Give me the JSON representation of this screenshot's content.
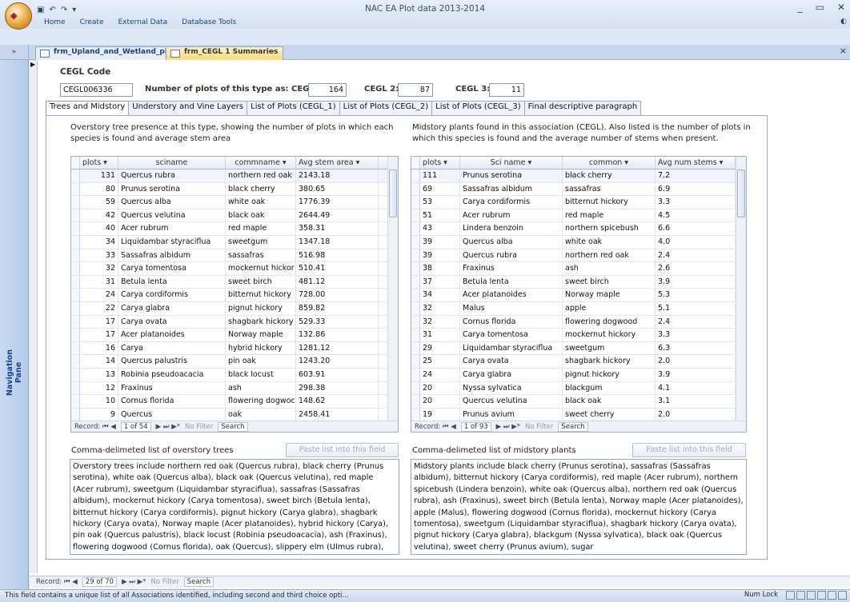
{
  "window": {
    "title": "NAC EA Plot data 2013-2014",
    "office_button": "Office",
    "quick_access": [
      "save-icon",
      "undo-icon",
      "redo-icon",
      "customize-icon"
    ],
    "controls": [
      "_",
      "▭",
      "✕"
    ]
  },
  "ribbon": {
    "tabs": [
      "Home",
      "Create",
      "External Data",
      "Database Tools"
    ],
    "help": "◐"
  },
  "doc_tabs": {
    "collapse": "»",
    "items": [
      "frm_Upland_and_Wetland_plots",
      "frm_CEGL 1 Summaries"
    ],
    "active": 1,
    "close": "×"
  },
  "nav_pane": {
    "label": "Navigation Pane"
  },
  "form": {
    "record_marker": "▶",
    "cegl_label": "CEGL Code",
    "cegl_value": "CEGL006336",
    "count_label_1": "Number of plots of this type as: CEGL 1:",
    "count_1": "164",
    "count_label_2": "CEGL 2:",
    "count_2": "87",
    "count_label_3": "CEGL 3:",
    "count_3": "11"
  },
  "tabs": [
    "Trees and Midstory",
    "Understory and Vine Layers",
    "List of Plots (CEGL_1)",
    "List of Plots (CEGL_2)",
    "List of Plots (CEGL_3)",
    "Final descriptive paragraph"
  ],
  "overstory": {
    "description": "Overstory tree presence at this type, showing the number of plots in which each species is found and average stem area",
    "columns": [
      "plots ▾",
      "sciname",
      "commname ▾",
      "Avg stem area ▾"
    ],
    "rows": [
      [
        "131",
        "Quercus rubra",
        "northern red oak",
        "2143.18"
      ],
      [
        "80",
        "Prunus serotina",
        "black cherry",
        "380.65"
      ],
      [
        "59",
        "Quercus alba",
        "white oak",
        "1776.39"
      ],
      [
        "42",
        "Quercus velutina",
        "black oak",
        "2644.49"
      ],
      [
        "40",
        "Acer rubrum",
        "red maple",
        "358.31"
      ],
      [
        "34",
        "Liquidambar styraciflua",
        "sweetgum",
        "1347.18"
      ],
      [
        "33",
        "Sassafras albidum",
        "sassafras",
        "516.98"
      ],
      [
        "32",
        "Carya tomentosa",
        "mockernut hickor",
        "510.41"
      ],
      [
        "31",
        "Betula lenta",
        "sweet birch",
        "481.12"
      ],
      [
        "24",
        "Carya cordiformis",
        "bitternut hickory",
        "728.00"
      ],
      [
        "22",
        "Carya glabra",
        "pignut hickory",
        "859.82"
      ],
      [
        "17",
        "Carya ovata",
        "shagbark hickory",
        "529.33"
      ],
      [
        "17",
        "Acer platanoides",
        "Norway maple",
        "132.86"
      ],
      [
        "16",
        "Carya",
        "hybrid hickory",
        "1281.12"
      ],
      [
        "14",
        "Quercus palustris",
        "pin oak",
        "1243.20"
      ],
      [
        "13",
        "Robinia pseudoacacia",
        "black locust",
        "603.91"
      ],
      [
        "12",
        "Fraxinus",
        "ash",
        "298.38"
      ],
      [
        "10",
        "Cornus florida",
        "flowering dogwoc",
        "148.62"
      ],
      [
        "9",
        "Quercus",
        "oak",
        "2458.41"
      ]
    ],
    "record_nav": {
      "label": "Record: ⏮ ◀",
      "position": "1 of 54",
      "after": "▶ ⏭ ▶*",
      "filter": "No Filter",
      "search": "Search"
    },
    "list_label": "Comma-delimeted list of overstory trees",
    "paste_button": "Paste list into this field",
    "list_text": "Overstory trees include northern red oak (Quercus rubra), black cherry (Prunus serotina), white oak (Quercus alba), black oak (Quercus velutina), red maple (Acer rubrum), sweetgum (Liquidambar styraciflua), sassafras (Sassafras albidum), mockernut hickory (Carya tomentosa), sweet birch (Betula lenta), bitternut hickory (Carya cordiformis), pignut hickory (Carya glabra), shagbark hickory (Carya ovata), Norway maple (Acer platanoides), hybrid hickory (Carya), pin oak (Quercus palustris), black locust (Robinia pseudoacacia), ash (Fraxinus), flowering dogwood (Cornus florida), oak (Quercus), slippery elm (Ulmus rubra),"
  },
  "midstory": {
    "description": "Midstory plants found in this association (CEGL). Also listed is the number of plots in which this species is found and the average number of stems when present.",
    "columns": [
      "plots ▾",
      "Sci name ▾",
      "common ▾",
      "Avg num stems ▾"
    ],
    "rows": [
      [
        "111",
        "Prunus serotina",
        "black cherry",
        "7.2"
      ],
      [
        "69",
        "Sassafras albidum",
        "sassafras",
        "6.9"
      ],
      [
        "53",
        "Carya cordiformis",
        "bitternut hickory",
        "3.3"
      ],
      [
        "51",
        "Acer rubrum",
        "red maple",
        "4.5"
      ],
      [
        "43",
        "Lindera benzoin",
        "northern spicebush",
        "6.6"
      ],
      [
        "39",
        "Quercus alba",
        "white oak",
        "4.0"
      ],
      [
        "39",
        "Quercus rubra",
        "northern red oak",
        "2.4"
      ],
      [
        "38",
        "Fraxinus",
        "ash",
        "2.6"
      ],
      [
        "37",
        "Betula lenta",
        "sweet birch",
        "3.9"
      ],
      [
        "34",
        "Acer platanoides",
        "Norway maple",
        "5.3"
      ],
      [
        "32",
        "Malus",
        "apple",
        "5.1"
      ],
      [
        "32",
        "Cornus florida",
        "flowering dogwood",
        "2.4"
      ],
      [
        "31",
        "Carya tomentosa",
        "mockernut hickory",
        "3.3"
      ],
      [
        "29",
        "Liquidambar styraciflua",
        "sweetgum",
        "6.3"
      ],
      [
        "25",
        "Carya ovata",
        "shagbark hickory",
        "2.0"
      ],
      [
        "24",
        "Carya glabra",
        "pignut hickory",
        "3.9"
      ],
      [
        "20",
        "Nyssa sylvatica",
        "blackgum",
        "4.1"
      ],
      [
        "20",
        "Quercus velutina",
        "black oak",
        "3.1"
      ],
      [
        "19",
        "Prunus avium",
        "sweet cherry",
        "2.0"
      ]
    ],
    "record_nav": {
      "label": "Record: ⏮ ◀",
      "position": "1 of 93",
      "after": "▶ ⏭ ▶*",
      "filter": "No Filter",
      "search": "Search"
    },
    "list_label": "Comma-delimeted list of midstory plants",
    "paste_button": "Paste list into this field",
    "list_text": "Midstory plants include black cherry (Prunus serotina), sassafras (Sassafras albidum), bitternut hickory (Carya cordiformis), red maple (Acer rubrum), northern spicebush (Lindera benzoin), white oak (Quercus alba), northern red oak (Quercus rubra), ash (Fraxinus), sweet birch (Betula lenta), Norway maple (Acer platanoides), apple (Malus), flowering dogwood (Cornus florida), mockernut hickory (Carya tomentosa), sweetgum (Liquidambar styraciflua), shagbark hickory (Carya ovata), pignut hickory (Carya glabra), blackgum (Nyssa sylvatica), black oak (Quercus velutina), sweet cherry (Prunus avium), sugar"
  },
  "form_nav": {
    "label": "Record: ⏮ ◀",
    "position": "29 of 70",
    "after": "▶ ⏭ ▶*",
    "filter": "No Filter",
    "search": "Search"
  },
  "status": {
    "message": "This field contains a unique list of all Associations identified, including second and third choice opti...",
    "numlock": "Num Lock"
  }
}
